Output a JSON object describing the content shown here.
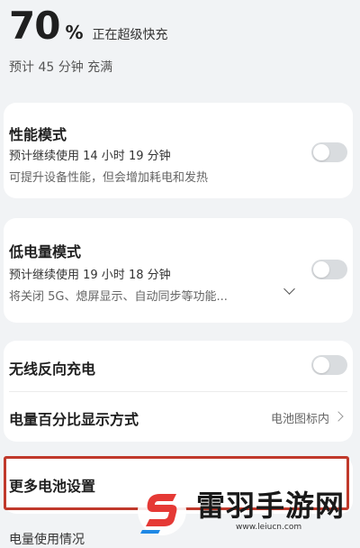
{
  "battery": {
    "percent": "70",
    "unit": "%",
    "status": "正在超级快充",
    "eta": "预计 45 分钟 充满"
  },
  "performance_mode": {
    "title": "性能模式",
    "estimate": "预计继续使用 14 小时 19 分钟",
    "description": "可提升设备性能，但会增加耗电和发热",
    "enabled": false
  },
  "low_power_mode": {
    "title": "低电量模式",
    "estimate": "预计继续使用 19 小时 18 分钟",
    "description": "将关闭 5G、熄屏显示、自动同步等功能...",
    "enabled": false
  },
  "wireless_reverse": {
    "title": "无线反向充电",
    "enabled": false
  },
  "percent_display": {
    "title": "电量百分比显示方式",
    "value": "电池图标内"
  },
  "more_settings": {
    "title": "更多电池设置"
  },
  "next_section": {
    "title": "电量使用情况"
  },
  "watermark": {
    "text": "雷羽手游网",
    "url": "www.leiucn.com",
    "brand_color": "#e53935"
  },
  "colors": {
    "background": "#f1f3f5",
    "card": "#ffffff",
    "toggle_off": "#d9dcdf",
    "highlight": "#c0392b"
  }
}
